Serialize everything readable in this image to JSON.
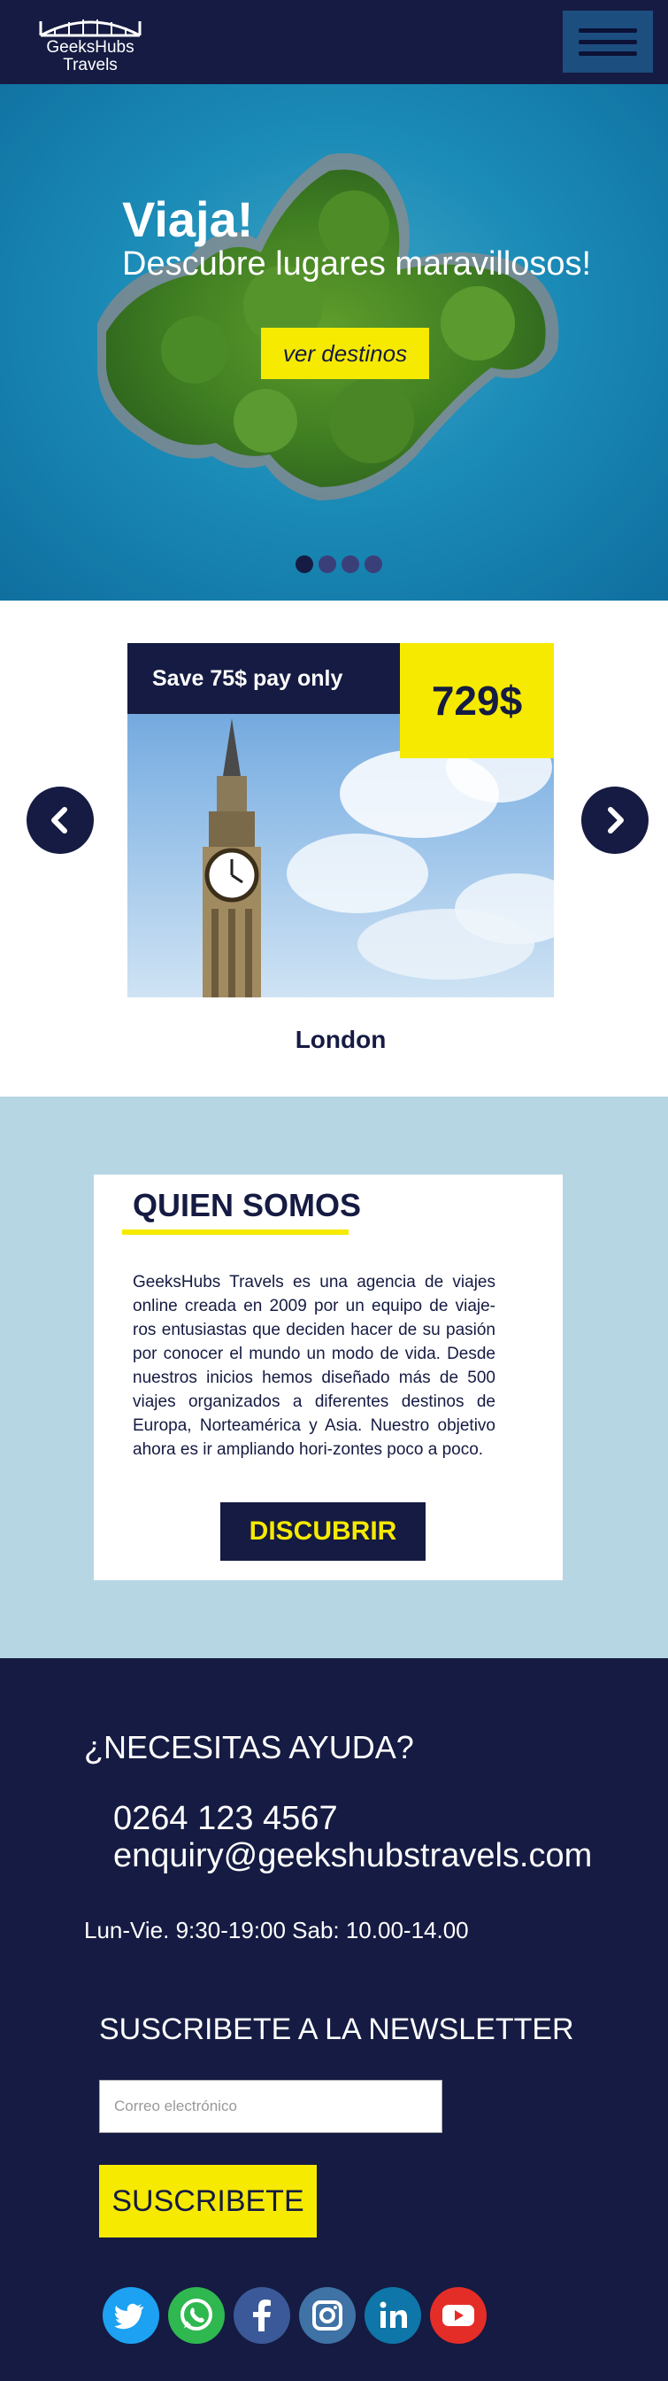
{
  "header": {
    "logo_line1": "GeeksHubs",
    "logo_line2": "Travels",
    "menu_icon": "hamburger-icon"
  },
  "hero": {
    "title": "Viaja!",
    "subtitle": "Descubre lugares maravillosos!",
    "button_label": "ver destinos",
    "slides_count": 4,
    "active_slide": 1
  },
  "offer": {
    "save_label": "Save 75$ pay only",
    "price": "729$",
    "destination": "London",
    "prev_icon": "chevron-left-icon",
    "next_icon": "chevron-right-icon"
  },
  "about": {
    "title": "QUIEN SOMOS",
    "text": "GeeksHubs Travels es una agencia de viajes online creada en 2009 por un equipo de viaje-ros entusiastas que deciden hacer de su pasión por conocer el mundo un modo de vida. Desde nuestros inicios hemos diseñado más de 500 viajes organizados a diferentes destinos de Europa, Norteamérica y Asia. Nuestro objetivo ahora es ir ampliando hori-zontes poco a poco.",
    "button_label": "DISCUBRIR"
  },
  "footer": {
    "help_title": "¿NECESITAS AYUDA?",
    "phone": "0264 123 4567",
    "email": "enquiry@geekshubstravels.com",
    "hours": "Lun-Vie. 9:30-19:00 Sab: 10.00-14.00",
    "newsletter_title": "SUSCRIBETE A LA NEWSLETTER",
    "email_placeholder": "Correo electrónico",
    "subscribe_label": "SUSCRIBETE"
  },
  "social": [
    {
      "name": "twitter-icon",
      "color": "#1da1f2"
    },
    {
      "name": "whatsapp-icon",
      "color": "#2fb84f"
    },
    {
      "name": "facebook-icon",
      "color": "#3b5998"
    },
    {
      "name": "instagram-icon",
      "color": "#3f72a5"
    },
    {
      "name": "linkedin-icon",
      "color": "#0e76a8"
    },
    {
      "name": "youtube-icon",
      "color": "#e52d27"
    }
  ],
  "colors": {
    "navy": "#151b42",
    "yellow": "#f6ea00",
    "light_blue": "#b6d6e3",
    "menu_blue": "#1c4f80"
  }
}
